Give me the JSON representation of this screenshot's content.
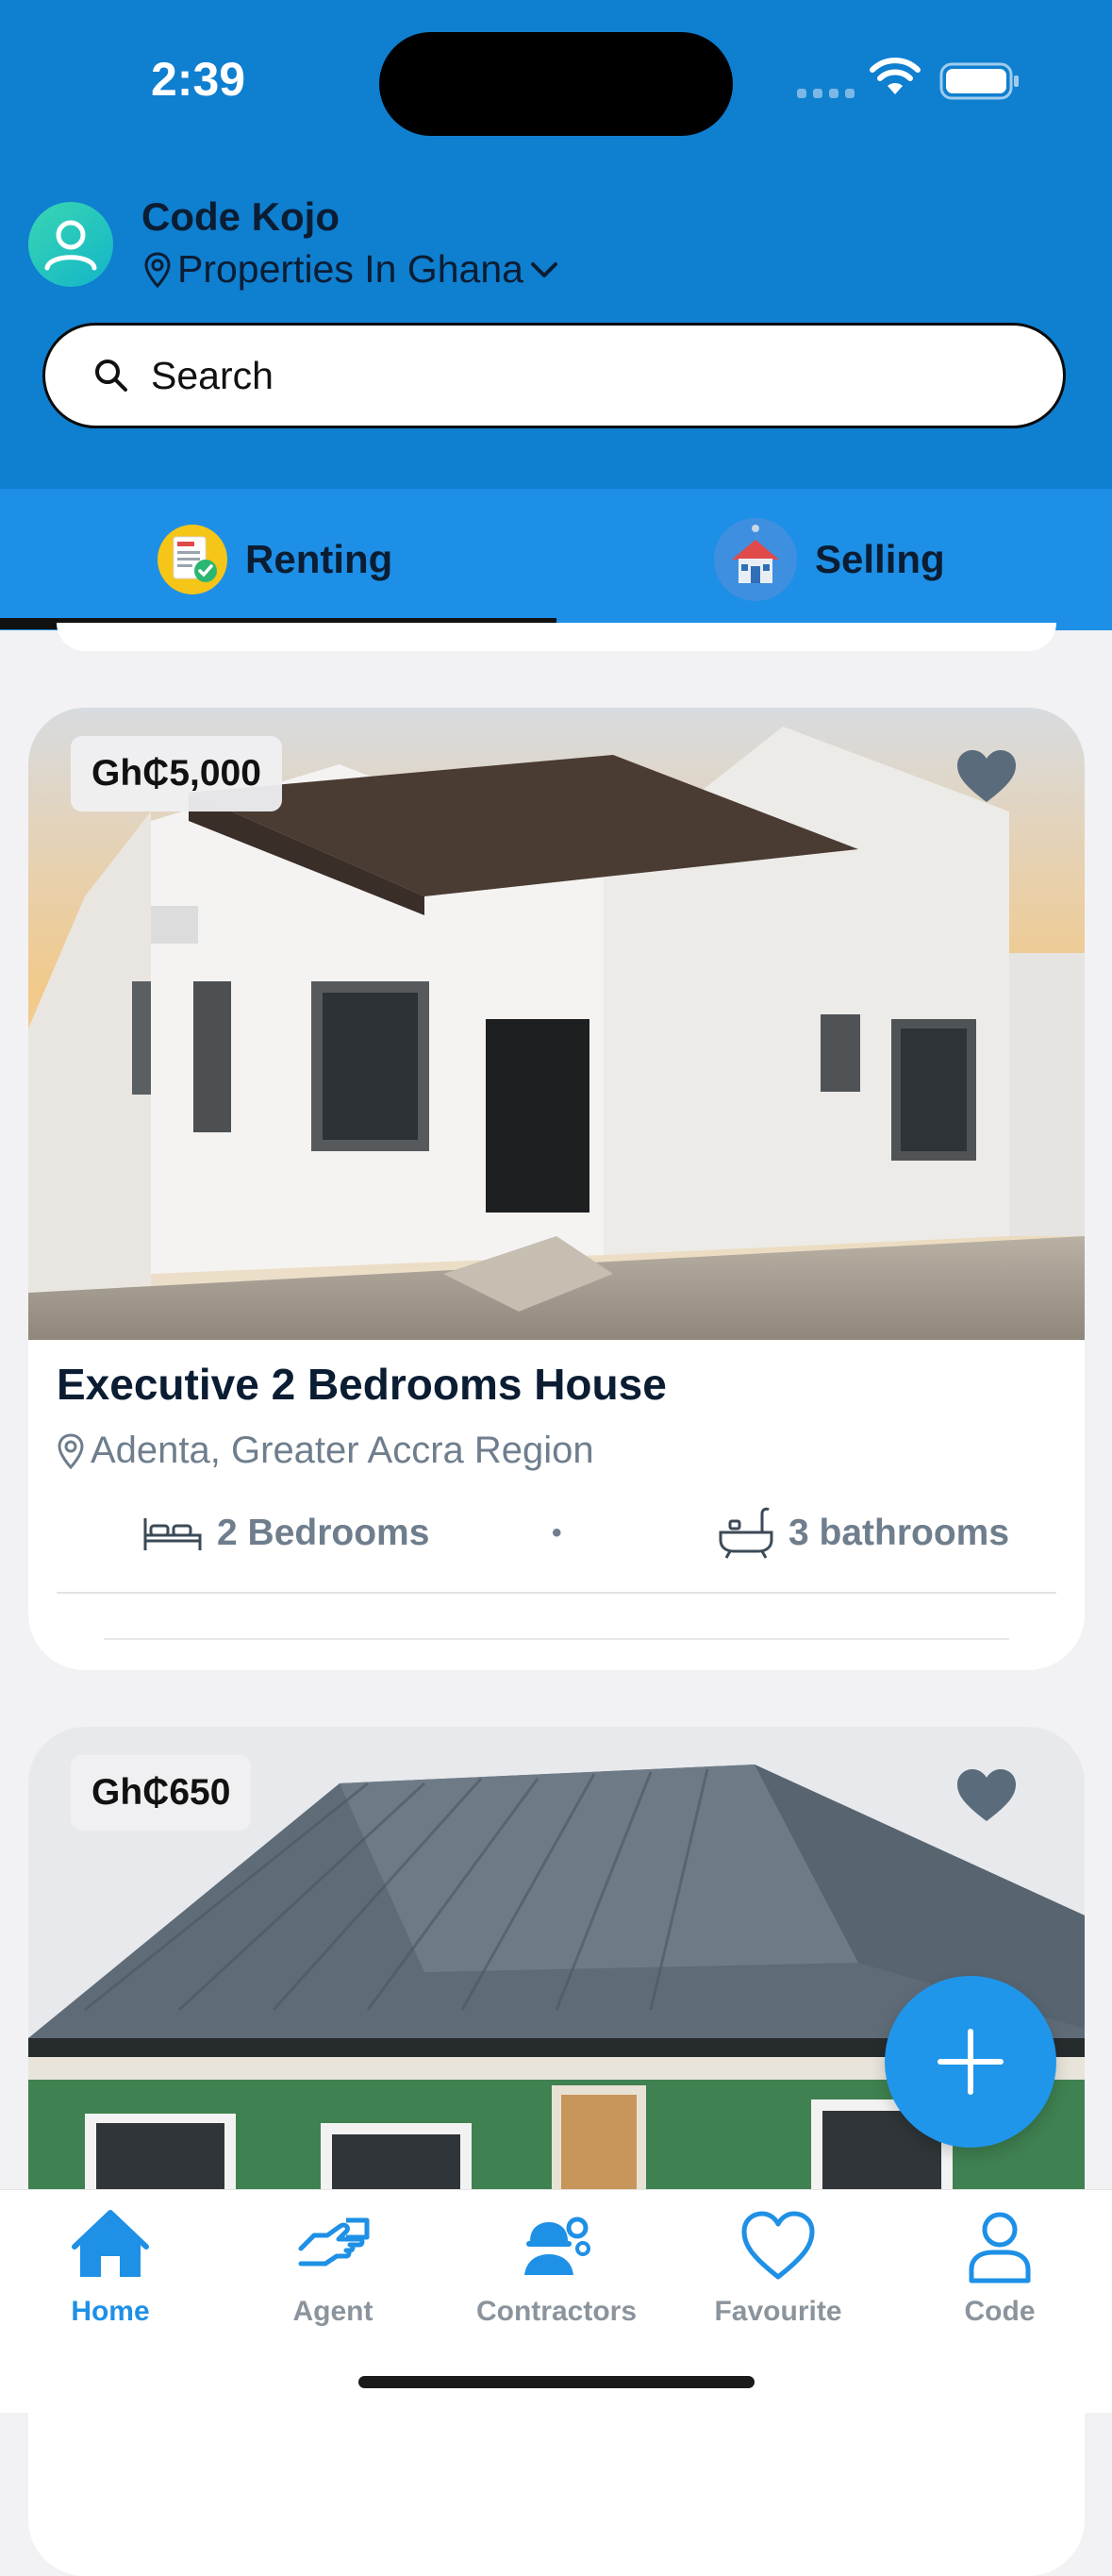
{
  "status_bar": {
    "time": "2:39"
  },
  "header": {
    "user_name": "Code Kojo",
    "location": "Properties In Ghana",
    "search": {
      "placeholder": "Search",
      "value": ""
    }
  },
  "tabs": [
    {
      "label": "Renting",
      "active": true
    },
    {
      "label": "Selling",
      "active": false
    }
  ],
  "listings": [
    {
      "price": "Gh₵5,000",
      "title": "Executive 2 Bedrooms House",
      "location": "Adenta, Greater Accra Region",
      "bedrooms": "2 Bedrooms",
      "separator": "•",
      "bathrooms": "3 bathrooms"
    },
    {
      "price": "Gh₵650"
    }
  ],
  "bottom_nav": [
    {
      "label": "Home",
      "icon": "home-icon",
      "active": true
    },
    {
      "label": "Agent",
      "icon": "agent-icon",
      "active": false
    },
    {
      "label": "Contractors",
      "icon": "contractors-icon",
      "active": false
    },
    {
      "label": "Favourite",
      "icon": "heart-icon",
      "active": false
    },
    {
      "label": "Code",
      "icon": "user-icon",
      "active": false
    }
  ],
  "colors": {
    "header_blue": "#0f7fd0",
    "tab_blue": "#1e8fe6",
    "accent": "#1e90e6",
    "fab": "#1f96ea",
    "muted_text": "#6f7e8d"
  }
}
